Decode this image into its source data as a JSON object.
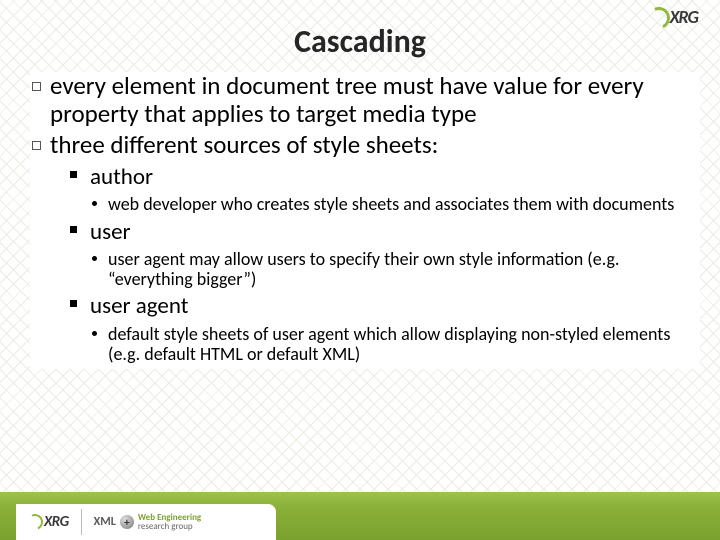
{
  "brand": {
    "name": "XRG",
    "sub_xml": "XML",
    "sub_group_top": "Web Engineering",
    "sub_group_bottom": "research group"
  },
  "title": "Cascading",
  "bullets": [
    "every element in document tree must have value for every property that applies to target media type",
    "three different sources of style sheets:"
  ],
  "sources": [
    {
      "label": "author",
      "detail": "web developer who creates style sheets and associates them with documents"
    },
    {
      "label": "user",
      "detail": "user agent may allow users to specify their own style information (e.g. “everything bigger”)"
    },
    {
      "label": "user agent",
      "detail": "default style sheets of user agent which allow displaying non-styled elements (e.g. default HTML or default XML)"
    }
  ]
}
